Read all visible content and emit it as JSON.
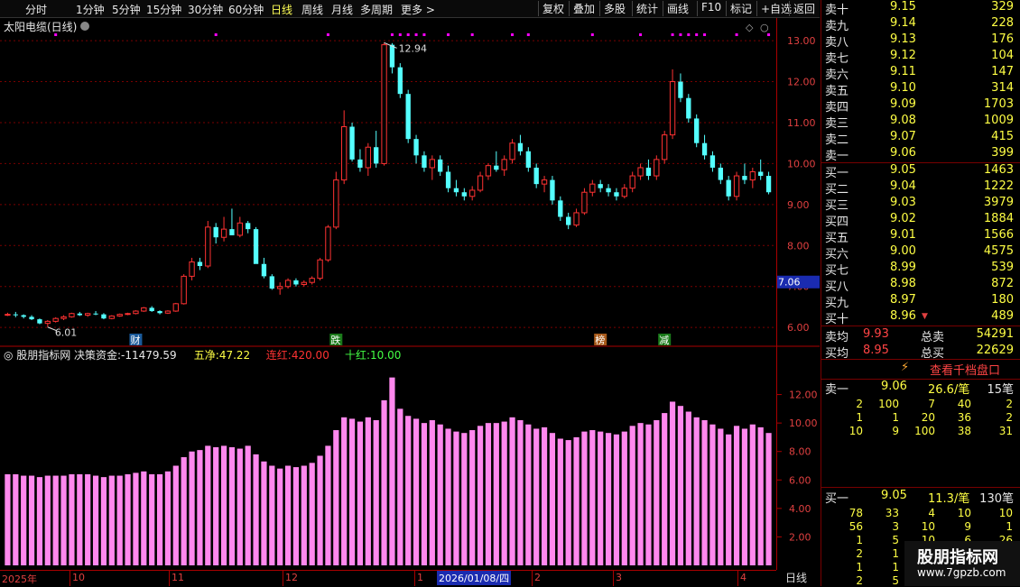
{
  "toolbar": {
    "periods": [
      "分时",
      "1分钟",
      "5分钟",
      "15分钟",
      "30分钟",
      "60分钟",
      "日线",
      "周线",
      "月线",
      "多周期",
      "更多"
    ],
    "active_period": "日线",
    "more_arrow": ">",
    "buttons": [
      "复权",
      "叠加",
      "多股",
      "统计",
      "画线",
      "F10",
      "标记",
      "+自选",
      "返回"
    ]
  },
  "main_chart": {
    "title": "太阳电缆(日线)",
    "price_ticks": [
      "13.00",
      "12.00",
      "11.00",
      "10.00",
      "9.00",
      "8.00",
      "7.00",
      "6.00"
    ],
    "current_price_tag": "7.06",
    "high_label": "12.94",
    "low_label": "6.01",
    "event_markers": [
      "财",
      "跌",
      "榜",
      "减"
    ],
    "colors": {
      "up": "#ff3232",
      "down": "#54ffff",
      "grid": "#7a0000",
      "magenta": "#ff00ff"
    }
  },
  "sub_chart": {
    "title": "股朋指标网",
    "params": [
      {
        "label": "决策资金:",
        "value": "-11479.59",
        "color": "#e8e8e8"
      },
      {
        "label": "五净:",
        "value": "47.22",
        "color": "#ffff44"
      },
      {
        "label": "连红:",
        "value": "420.00",
        "color": "#ff3232"
      },
      {
        "label": "十红:",
        "value": "10.00",
        "color": "#44ff44"
      }
    ],
    "value_ticks": [
      "12.00",
      "10.00",
      "8.00",
      "6.00",
      "4.00",
      "2.00"
    ],
    "bar_color": "#ff88ee"
  },
  "time_axis": {
    "labels": [
      "2025年",
      "10",
      "11",
      "12",
      "1",
      "2",
      "3",
      "4"
    ],
    "selected_date": "2026/01/08/四",
    "period_tab": "日线"
  },
  "quote_panel": {
    "sells": [
      {
        "label": "卖十",
        "price": "9.15",
        "vol": "329"
      },
      {
        "label": "卖九",
        "price": "9.14",
        "vol": "228"
      },
      {
        "label": "卖八",
        "price": "9.13",
        "vol": "176"
      },
      {
        "label": "卖七",
        "price": "9.12",
        "vol": "104"
      },
      {
        "label": "卖六",
        "price": "9.11",
        "vol": "147"
      },
      {
        "label": "卖五",
        "price": "9.10",
        "vol": "314"
      },
      {
        "label": "卖四",
        "price": "9.09",
        "vol": "1703"
      },
      {
        "label": "卖三",
        "price": "9.08",
        "vol": "1009"
      },
      {
        "label": "卖二",
        "price": "9.07",
        "vol": "415"
      },
      {
        "label": "卖一",
        "price": "9.06",
        "vol": "399"
      }
    ],
    "buys": [
      {
        "label": "买一",
        "price": "9.05",
        "vol": "1463"
      },
      {
        "label": "买二",
        "price": "9.04",
        "vol": "1222"
      },
      {
        "label": "买三",
        "price": "9.03",
        "vol": "3979"
      },
      {
        "label": "买四",
        "price": "9.02",
        "vol": "1884"
      },
      {
        "label": "买五",
        "price": "9.01",
        "vol": "1566"
      },
      {
        "label": "买六",
        "price": "9.00",
        "vol": "4575"
      },
      {
        "label": "买七",
        "price": "8.99",
        "vol": "539"
      },
      {
        "label": "买八",
        "price": "8.98",
        "vol": "872"
      },
      {
        "label": "买九",
        "price": "8.97",
        "vol": "180"
      },
      {
        "label": "买十",
        "price": "8.96",
        "vol": "489",
        "mark": "▼"
      }
    ],
    "summary": [
      {
        "label": "卖均",
        "price": "9.93",
        "label2": "总卖",
        "vol": "54291"
      },
      {
        "label": "买均",
        "price": "8.95",
        "label2": "总买",
        "vol": "22629"
      }
    ],
    "view_button": "查看千档盘口",
    "sell1_detail": {
      "label": "卖一",
      "price": "9.06",
      "per": "26.6/笔",
      "count": "15笔",
      "rows": [
        [
          "2",
          "100",
          "7",
          "40",
          "2"
        ],
        [
          "1",
          "1",
          "20",
          "36",
          "2"
        ],
        [
          "10",
          "9",
          "100",
          "38",
          "31"
        ]
      ]
    },
    "buy1_detail": {
      "label": "买一",
      "price": "9.05",
      "per": "11.3/笔",
      "count": "130笔",
      "rows": [
        [
          "78",
          "33",
          "4",
          "10",
          "10"
        ],
        [
          "56",
          "3",
          "10",
          "9",
          "1"
        ],
        [
          "1",
          "5",
          "10",
          "6",
          "26"
        ],
        [
          "2",
          "1",
          "",
          "",
          ""
        ],
        [
          "1",
          "1",
          "",
          "",
          ""
        ],
        [
          "2",
          "5",
          "",
          "",
          ""
        ]
      ]
    },
    "watermark": {
      "title": "股朋指标网",
      "url": "www.7gpzb.com"
    }
  },
  "chart_data": {
    "type": "candlestick",
    "title": "太阳电缆(日线)",
    "ylim": [
      5.85,
      13.2
    ],
    "series": [
      {
        "name": "daily",
        "ohlc": [
          [
            6.3,
            6.36,
            6.28,
            6.32
          ],
          [
            6.32,
            6.38,
            6.25,
            6.3
          ],
          [
            6.3,
            6.32,
            6.22,
            6.26
          ],
          [
            6.26,
            6.3,
            6.18,
            6.2
          ],
          [
            6.2,
            6.22,
            6.08,
            6.1
          ],
          [
            6.1,
            6.18,
            6.01,
            6.15
          ],
          [
            6.15,
            6.25,
            6.12,
            6.22
          ],
          [
            6.22,
            6.3,
            6.18,
            6.26
          ],
          [
            6.26,
            6.36,
            6.24,
            6.34
          ],
          [
            6.34,
            6.38,
            6.28,
            6.3
          ],
          [
            6.3,
            6.36,
            6.26,
            6.34
          ],
          [
            6.34,
            6.4,
            6.3,
            6.32
          ],
          [
            6.32,
            6.35,
            6.2,
            6.22
          ],
          [
            6.22,
            6.3,
            6.2,
            6.28
          ],
          [
            6.28,
            6.34,
            6.26,
            6.32
          ],
          [
            6.32,
            6.36,
            6.3,
            6.34
          ],
          [
            6.34,
            6.42,
            6.32,
            6.4
          ],
          [
            6.4,
            6.5,
            6.38,
            6.48
          ],
          [
            6.48,
            6.52,
            6.38,
            6.4
          ],
          [
            6.4,
            6.42,
            6.32,
            6.35
          ],
          [
            6.35,
            6.42,
            6.33,
            6.4
          ],
          [
            6.4,
            6.6,
            6.38,
            6.58
          ],
          [
            6.58,
            7.3,
            6.56,
            7.25
          ],
          [
            7.25,
            7.7,
            7.15,
            7.6
          ],
          [
            7.6,
            7.7,
            7.4,
            7.5
          ],
          [
            7.5,
            8.6,
            7.45,
            8.45
          ],
          [
            8.45,
            8.55,
            8.05,
            8.2
          ],
          [
            8.2,
            8.7,
            8.1,
            8.4
          ],
          [
            8.4,
            8.9,
            8.3,
            8.25
          ],
          [
            8.25,
            8.7,
            8.2,
            8.55
          ],
          [
            8.55,
            8.6,
            8.3,
            8.4
          ],
          [
            8.4,
            8.45,
            7.6,
            7.55
          ],
          [
            7.55,
            7.7,
            7.2,
            7.25
          ],
          [
            7.25,
            7.3,
            6.92,
            6.95
          ],
          [
            6.95,
            7.1,
            6.8,
            7.0
          ],
          [
            7.0,
            7.2,
            6.95,
            7.15
          ],
          [
            7.15,
            7.2,
            7.0,
            7.05
          ],
          [
            7.05,
            7.15,
            7.0,
            7.1
          ],
          [
            7.1,
            7.25,
            7.05,
            7.2
          ],
          [
            7.2,
            7.7,
            7.15,
            7.65
          ],
          [
            7.65,
            8.5,
            7.6,
            8.45
          ],
          [
            8.45,
            9.8,
            8.4,
            9.6
          ],
          [
            9.6,
            11.3,
            9.5,
            10.9
          ],
          [
            10.9,
            11.0,
            10.05,
            10.1
          ],
          [
            10.1,
            10.35,
            9.8,
            9.9
          ],
          [
            9.9,
            10.5,
            9.7,
            10.4
          ],
          [
            10.4,
            10.8,
            9.9,
            10.0
          ],
          [
            10.0,
            12.95,
            9.95,
            12.9
          ],
          [
            12.9,
            12.94,
            12.2,
            12.35
          ],
          [
            12.35,
            12.45,
            11.6,
            11.7
          ],
          [
            11.7,
            11.8,
            10.5,
            10.6
          ],
          [
            10.6,
            10.7,
            10.0,
            10.2
          ],
          [
            10.2,
            10.3,
            9.8,
            9.9
          ],
          [
            9.9,
            10.2,
            9.6,
            10.1
          ],
          [
            10.1,
            10.2,
            9.7,
            9.8
          ],
          [
            9.8,
            9.95,
            9.3,
            9.4
          ],
          [
            9.4,
            9.6,
            9.2,
            9.3
          ],
          [
            9.3,
            9.4,
            9.1,
            9.2
          ],
          [
            9.2,
            9.45,
            9.1,
            9.35
          ],
          [
            9.35,
            9.8,
            9.3,
            9.7
          ],
          [
            9.7,
            10.0,
            9.6,
            9.95
          ],
          [
            9.95,
            10.3,
            9.8,
            9.85
          ],
          [
            9.85,
            10.2,
            9.7,
            10.1
          ],
          [
            10.1,
            10.6,
            10.0,
            10.5
          ],
          [
            10.5,
            10.7,
            10.2,
            10.3
          ],
          [
            10.3,
            10.4,
            9.8,
            9.9
          ],
          [
            9.9,
            10.0,
            9.4,
            9.5
          ],
          [
            9.5,
            9.7,
            9.3,
            9.6
          ],
          [
            9.6,
            9.7,
            9.0,
            9.1
          ],
          [
            9.1,
            9.2,
            8.6,
            8.7
          ],
          [
            8.7,
            8.8,
            8.4,
            8.5
          ],
          [
            8.5,
            8.9,
            8.45,
            8.8
          ],
          [
            8.8,
            9.4,
            8.75,
            9.3
          ],
          [
            9.3,
            9.6,
            9.2,
            9.5
          ],
          [
            9.5,
            9.6,
            9.3,
            9.4
          ],
          [
            9.4,
            9.5,
            9.2,
            9.3
          ],
          [
            9.3,
            9.4,
            9.1,
            9.2
          ],
          [
            9.2,
            9.5,
            9.15,
            9.4
          ],
          [
            9.4,
            9.8,
            9.3,
            9.7
          ],
          [
            9.7,
            10.0,
            9.6,
            9.9
          ],
          [
            9.9,
            10.1,
            9.6,
            9.7
          ],
          [
            9.7,
            10.2,
            9.6,
            10.1
          ],
          [
            10.1,
            10.8,
            10.0,
            10.7
          ],
          [
            10.7,
            12.3,
            10.6,
            12.0
          ],
          [
            12.0,
            12.2,
            11.5,
            11.6
          ],
          [
            11.6,
            11.7,
            11.0,
            11.1
          ],
          [
            11.1,
            11.2,
            10.4,
            10.5
          ],
          [
            10.5,
            10.7,
            10.1,
            10.2
          ],
          [
            10.2,
            10.3,
            9.8,
            9.9
          ],
          [
            9.9,
            10.0,
            9.5,
            9.6
          ],
          [
            9.6,
            9.7,
            9.1,
            9.2
          ],
          [
            9.2,
            9.8,
            9.1,
            9.7
          ],
          [
            9.7,
            10.0,
            9.5,
            9.6
          ],
          [
            9.6,
            9.9,
            9.4,
            9.8
          ],
          [
            9.8,
            10.1,
            9.6,
            9.7
          ],
          [
            9.7,
            9.8,
            9.25,
            9.3
          ]
        ]
      },
      {
        "name": "indicator",
        "values": [
          6.4,
          6.4,
          6.3,
          6.3,
          6.2,
          6.3,
          6.3,
          6.3,
          6.4,
          6.4,
          6.4,
          6.3,
          6.2,
          6.3,
          6.3,
          6.4,
          6.5,
          6.6,
          6.4,
          6.4,
          6.6,
          7.0,
          7.6,
          8.0,
          8.1,
          8.4,
          8.3,
          8.4,
          8.3,
          8.2,
          8.4,
          7.8,
          7.3,
          7.0,
          6.8,
          7.0,
          6.9,
          7.0,
          7.2,
          7.7,
          8.4,
          9.5,
          10.4,
          10.3,
          10.1,
          10.4,
          10.2,
          11.6,
          13.2,
          11.0,
          10.5,
          10.3,
          10.0,
          10.2,
          9.9,
          9.6,
          9.4,
          9.3,
          9.5,
          9.8,
          10.0,
          10.0,
          10.1,
          10.4,
          10.2,
          9.9,
          9.6,
          9.7,
          9.3,
          8.9,
          8.8,
          9.0,
          9.4,
          9.5,
          9.4,
          9.3,
          9.2,
          9.4,
          9.8,
          10.0,
          9.9,
          10.2,
          10.7,
          11.5,
          11.2,
          10.8,
          10.4,
          10.2,
          9.9,
          9.6,
          9.2,
          9.8,
          9.6,
          9.9,
          9.7,
          9.3
        ]
      }
    ],
    "indicator_ylim": [
      0,
      14
    ],
    "time_labels": [
      "2025年",
      "10",
      "11",
      "12",
      "1",
      "2",
      "3",
      "4"
    ]
  }
}
